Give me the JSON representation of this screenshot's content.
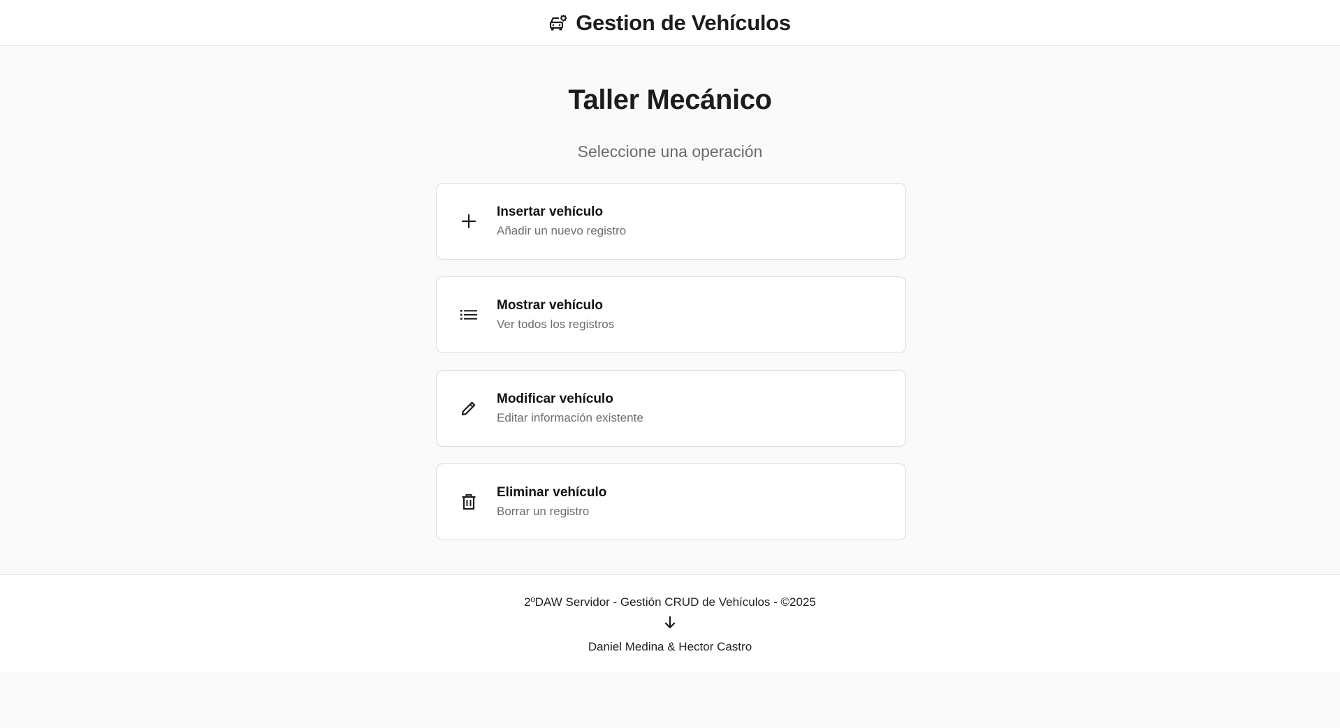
{
  "header": {
    "icon": "car-repair-icon",
    "title": "Gestion de Vehículos"
  },
  "main": {
    "title": "Taller Mecánico",
    "subtitle": "Seleccione una operación",
    "operations": [
      {
        "icon": "plus-icon",
        "title": "Insertar vehículo",
        "description": "Añadir un nuevo registro"
      },
      {
        "icon": "list-icon",
        "title": "Mostrar vehículo",
        "description": "Ver todos los registros"
      },
      {
        "icon": "pencil-icon",
        "title": "Modificar vehículo",
        "description": "Editar información existente"
      },
      {
        "icon": "trash-icon",
        "title": "Eliminar vehículo",
        "description": "Borrar un registro"
      }
    ]
  },
  "footer": {
    "line1": "2ºDAW Servidor - Gestión CRUD de Vehículos - ©2025",
    "arrow_icon": "arrow-down-icon",
    "line2": "Daniel Medina & Hector Castro"
  },
  "colors": {
    "background": "#fafafa",
    "surface": "#ffffff",
    "border": "#dcdcdc",
    "text": "#1c1c1c",
    "muted": "#6e6e6e"
  }
}
